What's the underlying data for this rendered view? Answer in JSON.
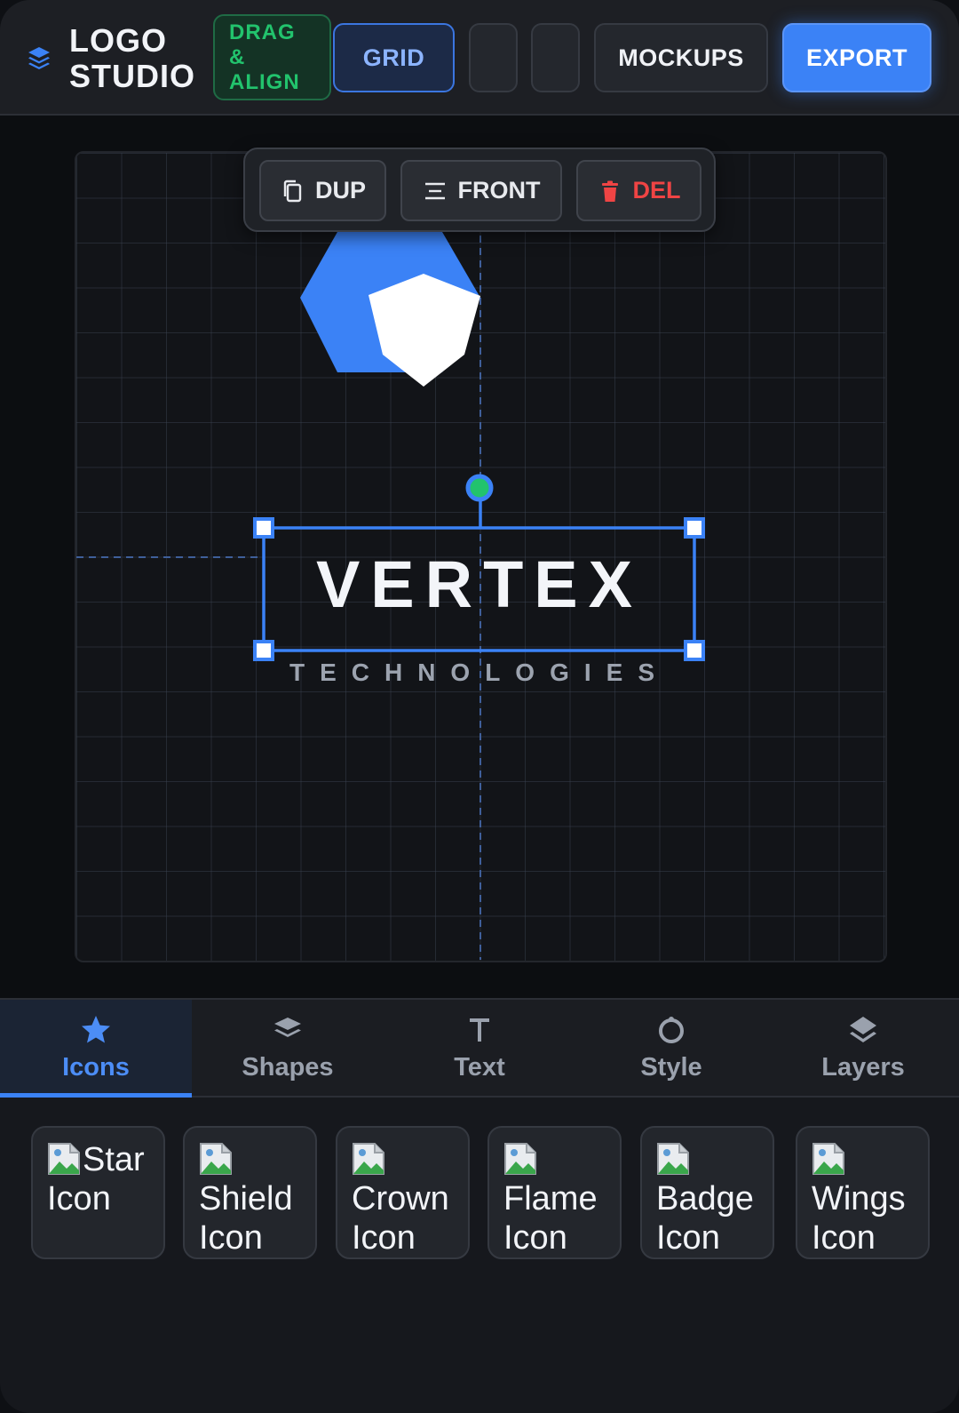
{
  "header": {
    "brand_line1": "LOGO",
    "brand_line2": "STUDIO",
    "drag_line1": "DRAG",
    "drag_line2": "&",
    "drag_line3": "ALIGN",
    "grid_label": "GRID",
    "mockups_label": "MOCKUPS",
    "export_label": "EXPORT"
  },
  "toolbar": {
    "dup_label": "DUP",
    "front_label": "FRONT",
    "del_label": "DEL"
  },
  "canvas": {
    "title": "VERTEX",
    "subtitle": "TECHNOLOGIES"
  },
  "tabs": [
    {
      "label": "Icons",
      "icon": "star-icon",
      "active": true
    },
    {
      "label": "Shapes",
      "icon": "stack-icon",
      "active": false
    },
    {
      "label": "Text",
      "icon": "text-t-icon",
      "active": false
    },
    {
      "label": "Style",
      "icon": "palette-ring-icon",
      "active": false
    },
    {
      "label": "Layers",
      "icon": "layers-icon",
      "active": false
    }
  ],
  "icons": [
    {
      "label": "Star Icon"
    },
    {
      "label": "Shield Icon"
    },
    {
      "label": "Crown Icon"
    },
    {
      "label": "Flame Icon"
    },
    {
      "label": "Badge Icon"
    },
    {
      "label": "Wings Icon"
    }
  ],
  "colors": {
    "accent": "#3b82f6",
    "success": "#22c36d",
    "danger": "#ef4444",
    "background": "#16181d"
  }
}
